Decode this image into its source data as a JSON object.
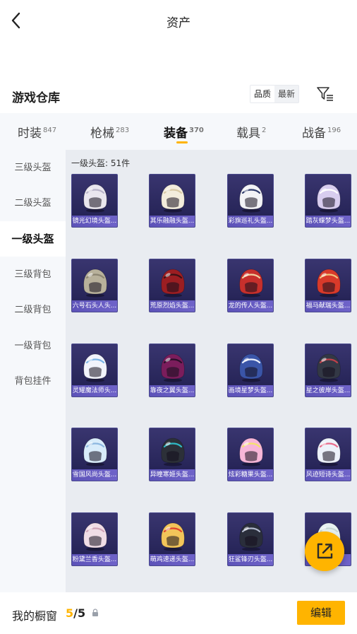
{
  "header": {
    "title": "资产"
  },
  "section": {
    "title": "游戏仓库",
    "sort_options": [
      "品质",
      "最新"
    ],
    "sort_active": "品质"
  },
  "tabs": [
    {
      "label": "时装",
      "count": "847"
    },
    {
      "label": "枪械",
      "count": "283"
    },
    {
      "label": "装备",
      "count": "370",
      "active": true
    },
    {
      "label": "载具",
      "count": "2"
    },
    {
      "label": "战备",
      "count": "196"
    }
  ],
  "sidebar": {
    "items": [
      {
        "label": "三级头盔"
      },
      {
        "label": "二级头盔"
      },
      {
        "label": "一级头盔",
        "active": true
      },
      {
        "label": "三级背包"
      },
      {
        "label": "二级背包"
      },
      {
        "label": "一级背包"
      },
      {
        "label": "背包挂件"
      }
    ]
  },
  "grid": {
    "count_label": "一级头盔: 51件",
    "items": [
      {
        "name": "镜光幻境头盔...",
        "color": "#e9e6ee",
        "accent": "#b8b3c8"
      },
      {
        "name": "其乐融融头盔...",
        "color": "#f3ecdc",
        "accent": "#d8c8a4"
      },
      {
        "name": "彩旗巡礼头盔...",
        "color": "#f2f2f6",
        "accent": "#2e3a6a"
      },
      {
        "name": "踏灰蝶梦头盔...",
        "color": "#d8cdef",
        "accent": "#ffffff"
      },
      {
        "name": "六号石头人头...",
        "color": "#b8b19b",
        "accent": "#8c8572"
      },
      {
        "name": "荒原烈焰头盔...",
        "color": "#9c1e22",
        "accent": "#3a1216"
      },
      {
        "name": "龙的传人头盔...",
        "color": "#c7302c",
        "accent": "#f1d3a0"
      },
      {
        "name": "福马献瑞头盔...",
        "color": "#d83a2a",
        "accent": "#f1c27a"
      },
      {
        "name": "灵耀魔法师头...",
        "color": "#f1f3fb",
        "accent": "#7ab4e6"
      },
      {
        "name": "靠夜之翼头盔...",
        "color": "#7b1d5c",
        "accent": "#2a0f2a"
      },
      {
        "name": "画境星梦头盔...",
        "color": "#3a55a8",
        "accent": "#e8eefc"
      },
      {
        "name": "星之彼岸头盔...",
        "color": "#333845",
        "accent": "#c0404a"
      },
      {
        "name": "雪国风尚头盔...",
        "color": "#d8ecfa",
        "accent": "#8cb7e0"
      },
      {
        "name": "异瞳寒姬头盔...",
        "color": "#2c3038",
        "accent": "#2eb8c4"
      },
      {
        "name": "炫彩糖果头盔...",
        "color": "#f7b6d8",
        "accent": "#f5e36a"
      },
      {
        "name": "风迹短诗头盔...",
        "color": "#edf2fa",
        "accent": "#e86b8b"
      },
      {
        "name": "粉黛兰香头盔...",
        "color": "#f0dde6",
        "accent": "#cfa3b6"
      },
      {
        "name": "萌鸡速递头盔...",
        "color": "#f2c55a",
        "accent": "#e0452d"
      },
      {
        "name": "狂鲨锋刃头盔...",
        "color": "#2a2e3b",
        "accent": "#b0b8cc"
      },
      {
        "name": "...",
        "color": "#e8f2f0",
        "accent": "#c8d8d4"
      }
    ]
  },
  "bottom": {
    "label": "我的橱窗",
    "current": "5",
    "separator": "/",
    "total": "5",
    "edit_label": "编辑"
  },
  "colors": {
    "accent": "#ffb400",
    "card_bg": "#2c2a62",
    "caption_bg": "#6358c0"
  }
}
